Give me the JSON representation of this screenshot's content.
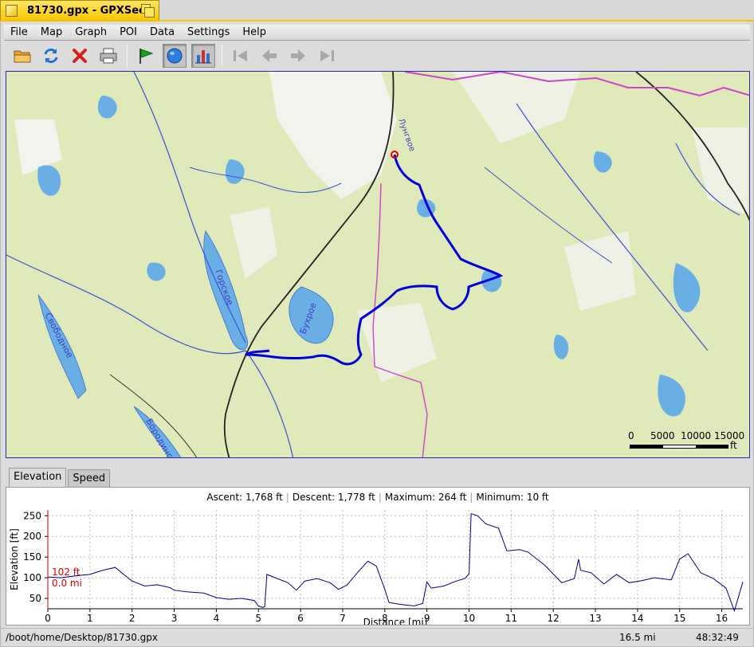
{
  "window": {
    "title": "81730.gpx - GPXSee"
  },
  "menu": [
    "File",
    "Map",
    "Graph",
    "POI",
    "Data",
    "Settings",
    "Help"
  ],
  "toolbar": {
    "buttons": [
      {
        "name": "open-file-button",
        "icon": "folder-icon"
      },
      {
        "name": "reload-button",
        "icon": "reload-icon"
      },
      {
        "name": "close-file-button",
        "icon": "close-icon"
      },
      {
        "name": "print-button",
        "icon": "printer-icon"
      },
      {
        "name": "show-poi-button",
        "icon": "flag-icon"
      },
      {
        "name": "show-map-button",
        "icon": "globe-icon",
        "active": true
      },
      {
        "name": "show-graphs-button",
        "icon": "chart-icon",
        "active": true
      },
      {
        "name": "first-file-button",
        "icon": "first-icon",
        "disabled": true
      },
      {
        "name": "previous-file-button",
        "icon": "previous-icon",
        "disabled": true
      },
      {
        "name": "next-file-button",
        "icon": "next-icon",
        "disabled": true
      },
      {
        "name": "last-file-button",
        "icon": "last-icon",
        "disabled": true
      }
    ]
  },
  "map": {
    "labels": [
      "Горское",
      "Бухрое",
      "Свободное",
      "Бородинское",
      "Лунгвое"
    ],
    "scale": {
      "ticks": [
        "0",
        "5000",
        "10000",
        "15000"
      ],
      "unit": "ft"
    },
    "colors": {
      "land": "#dfe9b9",
      "water": "#6aaee6",
      "track": "#0000dd",
      "road": "#222222",
      "border": "#cc44cc"
    }
  },
  "tabs": [
    {
      "label": "Elevation",
      "selected": true
    },
    {
      "label": "Speed",
      "selected": false
    }
  ],
  "graph": {
    "info": {
      "ascent": "Ascent: 1,768 ft",
      "descent": "Descent: 1,778 ft",
      "maximum": "Maximum: 264 ft",
      "minimum": "Minimum: 10 ft"
    },
    "slider": {
      "elevation": "102 ft",
      "distance": "0.0 mi"
    }
  },
  "chart_data": {
    "type": "line",
    "xlabel": "Distance [mi]",
    "ylabel": "Elevation [ft]",
    "xlim": [
      0,
      16.5
    ],
    "ylim": [
      25,
      264
    ],
    "x_ticks": [
      0,
      1,
      2,
      3,
      4,
      5,
      6,
      7,
      8,
      9,
      10,
      11,
      12,
      13,
      14,
      15,
      16
    ],
    "y_ticks": [
      50,
      100,
      150,
      200,
      250
    ],
    "grid": true,
    "series": [
      {
        "color": "#00008b",
        "x": [
          0,
          0.3,
          0.7,
          1.0,
          1.3,
          1.6,
          1.8,
          2.0,
          2.3,
          2.6,
          2.9,
          3.0,
          3.3,
          3.7,
          4.0,
          4.3,
          4.6,
          4.9,
          5.0,
          5.1,
          5.15,
          5.2,
          5.4,
          5.7,
          5.9,
          6.1,
          6.4,
          6.7,
          6.9,
          7.1,
          7.4,
          7.6,
          7.8,
          8.0,
          8.1,
          8.4,
          8.7,
          8.9,
          9.0,
          9.1,
          9.4,
          9.7,
          9.9,
          10.0,
          10.05,
          10.2,
          10.4,
          10.7,
          10.9,
          11.2,
          11.4,
          11.8,
          12.2,
          12.5,
          12.6,
          12.65,
          12.9,
          13.2,
          13.5,
          13.8,
          14.1,
          14.4,
          14.8,
          15.0,
          15.2,
          15.5,
          15.8,
          16.1,
          16.3,
          16.5
        ],
        "values": [
          102,
          100,
          105,
          108,
          118,
          125,
          108,
          92,
          80,
          83,
          76,
          70,
          66,
          63,
          52,
          48,
          50,
          45,
          32,
          28,
          30,
          108,
          100,
          88,
          70,
          92,
          98,
          88,
          72,
          82,
          118,
          140,
          128,
          72,
          40,
          35,
          32,
          38,
          90,
          75,
          80,
          92,
          98,
          110,
          255,
          250,
          230,
          220,
          165,
          168,
          162,
          130,
          88,
          98,
          145,
          118,
          112,
          85,
          108,
          88,
          93,
          100,
          95,
          145,
          158,
          112,
          98,
          75,
          20,
          90
        ]
      }
    ]
  },
  "status": {
    "path": "/boot/home/Desktop/81730.gpx",
    "distance": "16.5 mi",
    "time": "48:32:49"
  }
}
